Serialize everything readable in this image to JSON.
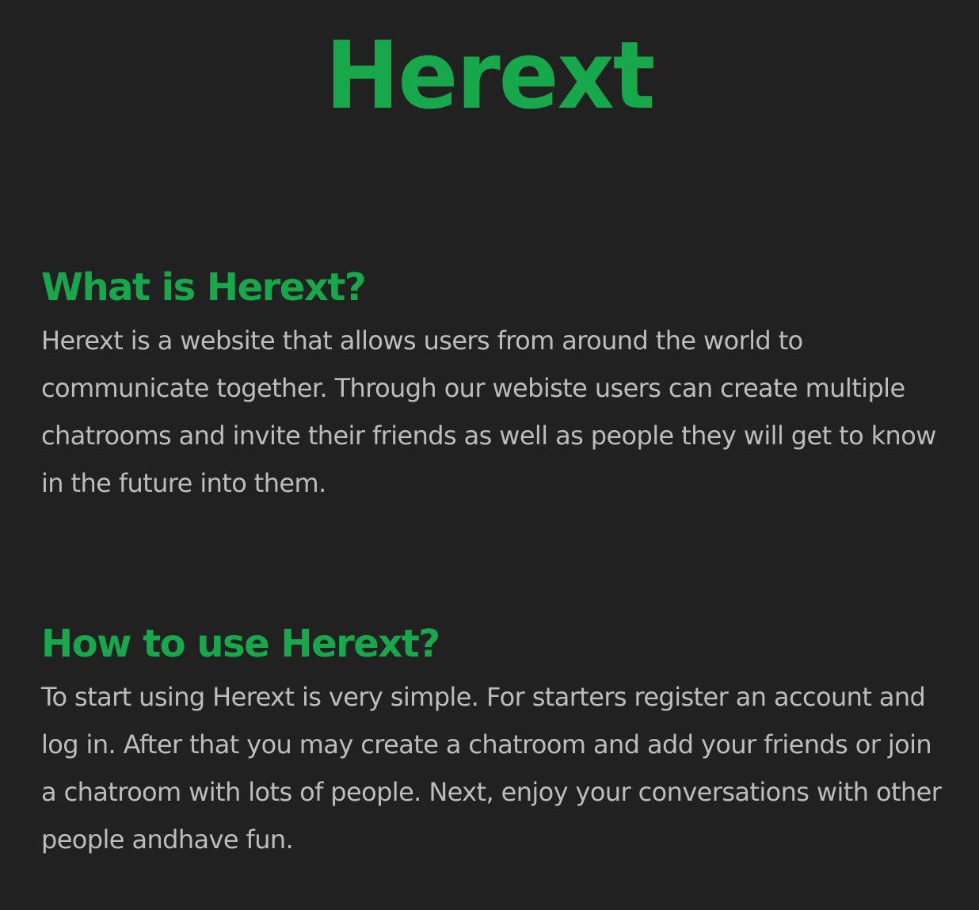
{
  "header": {
    "title": "Herext"
  },
  "sections": [
    {
      "heading": "What is Herext?",
      "body": "Herext is a website that allows users from around the world to communicate together. Through our webiste users can create multiple chatrooms and invite their friends as well as people they will get to know in the future into them."
    },
    {
      "heading": "How to use Herext?",
      "body": "To start using Herext is very simple. For starters register an account and log in. After that you may create a chatroom and add your friends or join a chatroom with lots of people. Next, enjoy your conversations with other people andhave fun."
    }
  ],
  "colors": {
    "background": "#212121",
    "accent": "#16a84a",
    "body_text": "#bdbdbd"
  }
}
